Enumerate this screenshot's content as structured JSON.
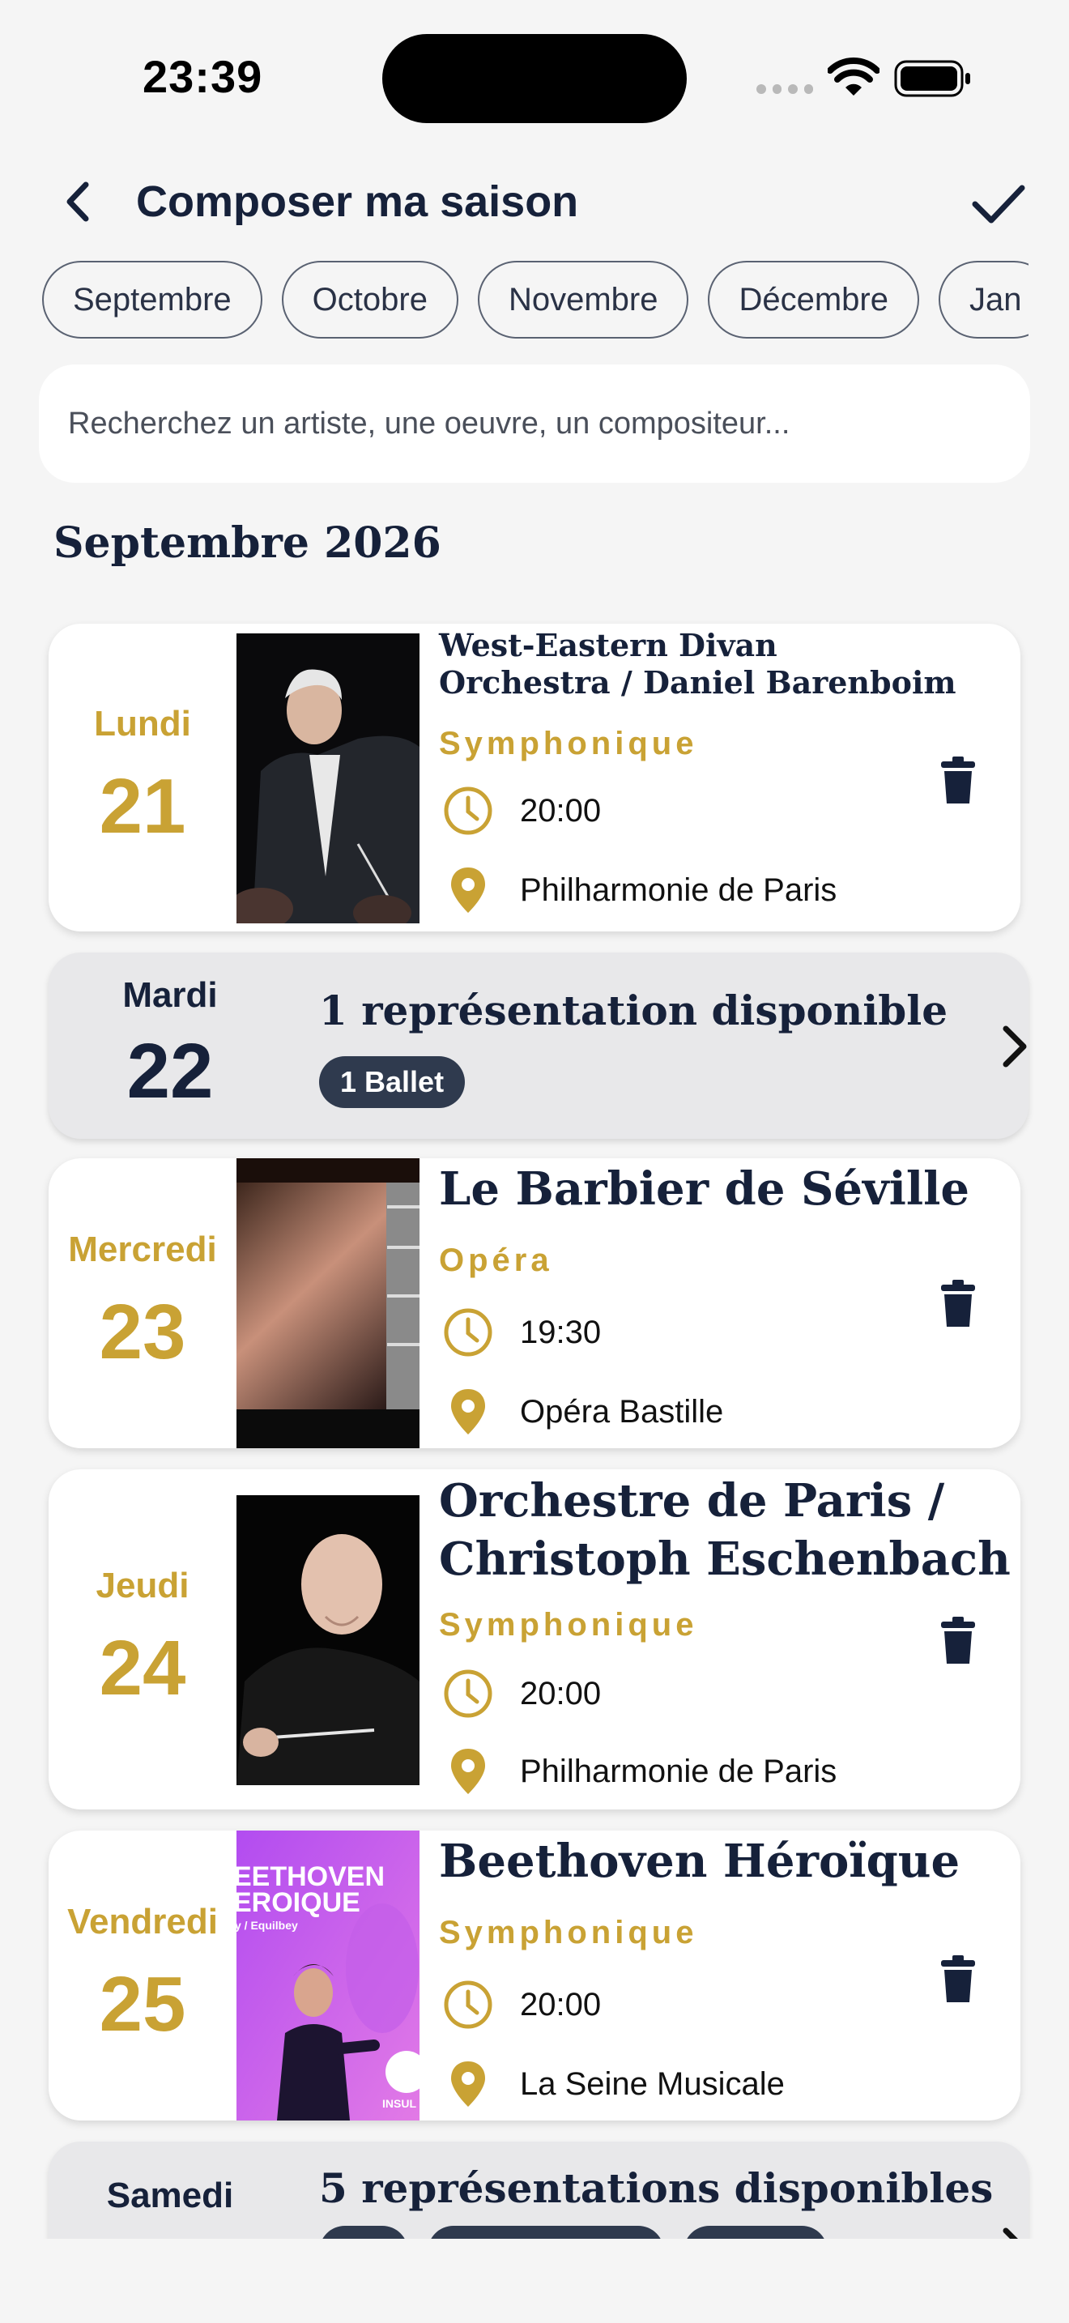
{
  "status_bar": {
    "time": "23:39"
  },
  "header": {
    "title": "Composer ma saison"
  },
  "months": [
    "Septembre",
    "Octobre",
    "Novembre",
    "Décembre",
    "Jan"
  ],
  "search": {
    "placeholder": "Recherchez un artiste, une oeuvre, un compositeur..."
  },
  "section": {
    "title": "Septembre 2026"
  },
  "events": [
    {
      "day": "Lundi",
      "date": "21",
      "title_line1": "West-Eastern Divan",
      "title_line2": "Orchestra / Daniel Barenboim",
      "genre": "Symphonique",
      "time": "20:00",
      "venue": "Philharmonie de Paris"
    },
    {
      "day": "Mercredi",
      "date": "23",
      "title_line1": "Le Barbier de Séville",
      "genre": "Opéra",
      "time": "19:30",
      "venue": "Opéra Bastille"
    },
    {
      "day": "Jeudi",
      "date": "24",
      "title_line1": "Orchestre de Paris /",
      "title_line2": "Christoph Eschenbach",
      "genre": "Symphonique",
      "time": "20:00",
      "venue": "Philharmonie de Paris"
    },
    {
      "day": "Vendredi",
      "date": "25",
      "title_line1": "Beethoven Héroïque",
      "genre": "Symphonique",
      "time": "20:00",
      "venue": "La Seine Musicale",
      "poster_text_1": "EETHOVEN",
      "poster_text_2": "EROIQUE",
      "poster_text_3": "y / Equilbey",
      "poster_brand": "INSUL"
    }
  ],
  "available": [
    {
      "day": "Mardi",
      "date": "22",
      "text": "1 représentation disponible",
      "tags": [
        "1 Ballet"
      ]
    },
    {
      "day": "Samedi",
      "text": "5 représentations disponibles"
    }
  ],
  "colors": {
    "gold": "#c9a234",
    "navy": "#16213a",
    "pill": "#2f3a4e"
  }
}
